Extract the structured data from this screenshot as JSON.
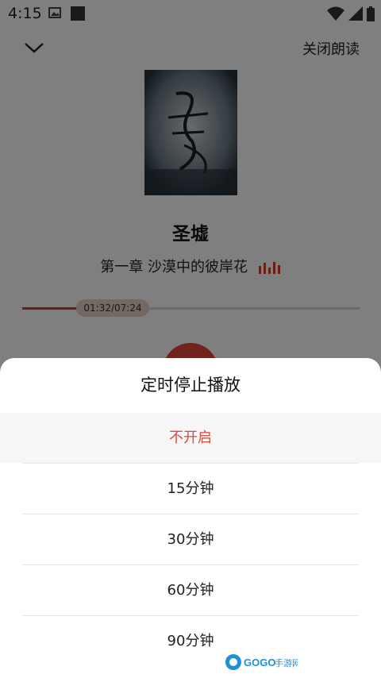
{
  "status_bar": {
    "time": "4:15"
  },
  "header": {
    "close_reading_label": "关闭朗读"
  },
  "book": {
    "title": "圣墟",
    "chapter": "第一章 沙漠中的彼岸花"
  },
  "player": {
    "time_label": "01:32/07:24",
    "progress_fraction": 0.207
  },
  "sheet": {
    "title": "定时停止播放",
    "options": [
      "不开启",
      "15分钟",
      "30分钟",
      "60分钟",
      "90分钟"
    ],
    "selected_index": 0
  },
  "colors": {
    "accent": "#d84b3d",
    "progress": "#d23c2d"
  },
  "watermark": {
    "text": "GOGO手游网"
  }
}
